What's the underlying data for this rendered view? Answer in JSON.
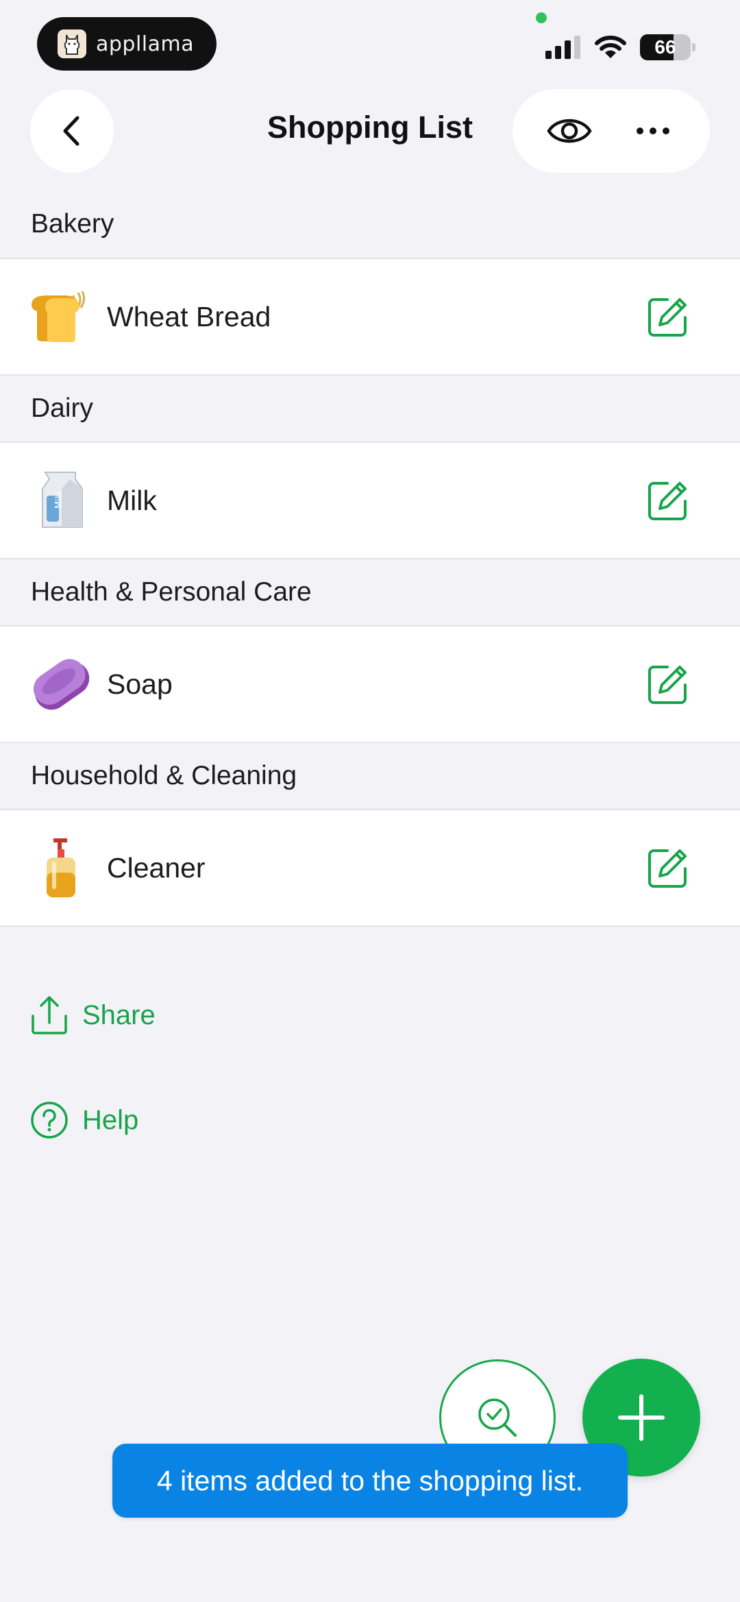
{
  "status_bar": {
    "app_badge": "appllama",
    "battery": "66",
    "icons": [
      "signal-icon",
      "wifi-icon",
      "battery-icon"
    ]
  },
  "header": {
    "title": "Shopping List",
    "icons": [
      "chevron-left-icon",
      "eye-icon",
      "more-icon"
    ]
  },
  "sections": [
    {
      "header": "Bakery",
      "item": {
        "name": "Wheat Bread",
        "icon": "bread-icon"
      }
    },
    {
      "header": "Dairy",
      "item": {
        "name": "Milk",
        "icon": "milk-icon"
      }
    },
    {
      "header": "Health & Personal Care",
      "item": {
        "name": "Soap",
        "icon": "soap-icon"
      }
    },
    {
      "header": "Household & Cleaning",
      "item": {
        "name": "Cleaner",
        "icon": "cleaner-icon"
      }
    }
  ],
  "links": {
    "share": "Share",
    "help": "Help"
  },
  "toast": {
    "message": "4 items added to the shopping list."
  },
  "colors": {
    "accent": "#13b04f",
    "toast_bg": "#0a84e4",
    "background": "#f3f2f7"
  }
}
